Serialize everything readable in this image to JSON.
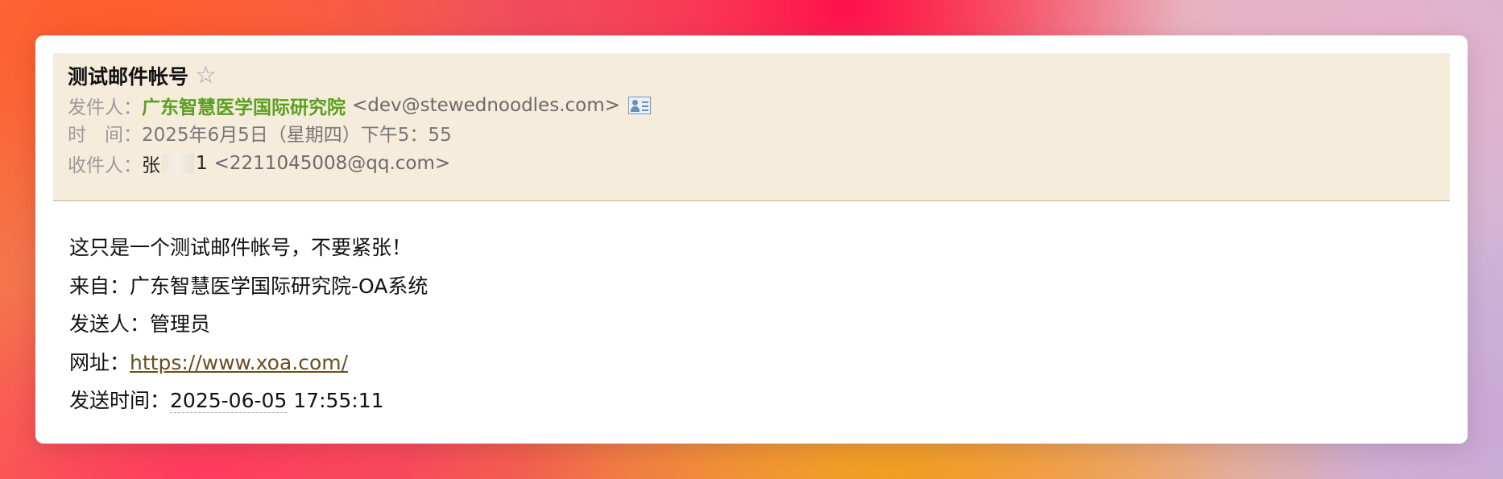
{
  "email": {
    "subject": "测试邮件帐号",
    "star_icon": "☆",
    "from_label": "发件人：",
    "from_name": "广东智慧医学国际研究院",
    "from_address": "<dev@stewednoodles.com>",
    "time_label": "时　间：",
    "time_value": "2025年6月5日（星期四）下午5：55",
    "to_label": "收件人：",
    "to_name_prefix": "张",
    "to_name_suffix": "1",
    "to_address": "<2211045008@qq.com>"
  },
  "body": {
    "line1": "这只是一个测试邮件帐号，不要紧张！",
    "from_line_label": "来自：",
    "from_line_value": "广东智慧医学国际研究院-OA系统",
    "sender_line_label": "发送人：",
    "sender_line_value": "管理员",
    "url_label": "网址：",
    "url_value": "https://www.xoa.com/",
    "sent_time_label": "发送时间：",
    "sent_date": "2025-06-05",
    "sent_time": " 17:55:11"
  },
  "colors": {
    "header_bg": "#f5ecdc",
    "sender_green": "#5aa01f",
    "link_brown": "#6b5020"
  }
}
